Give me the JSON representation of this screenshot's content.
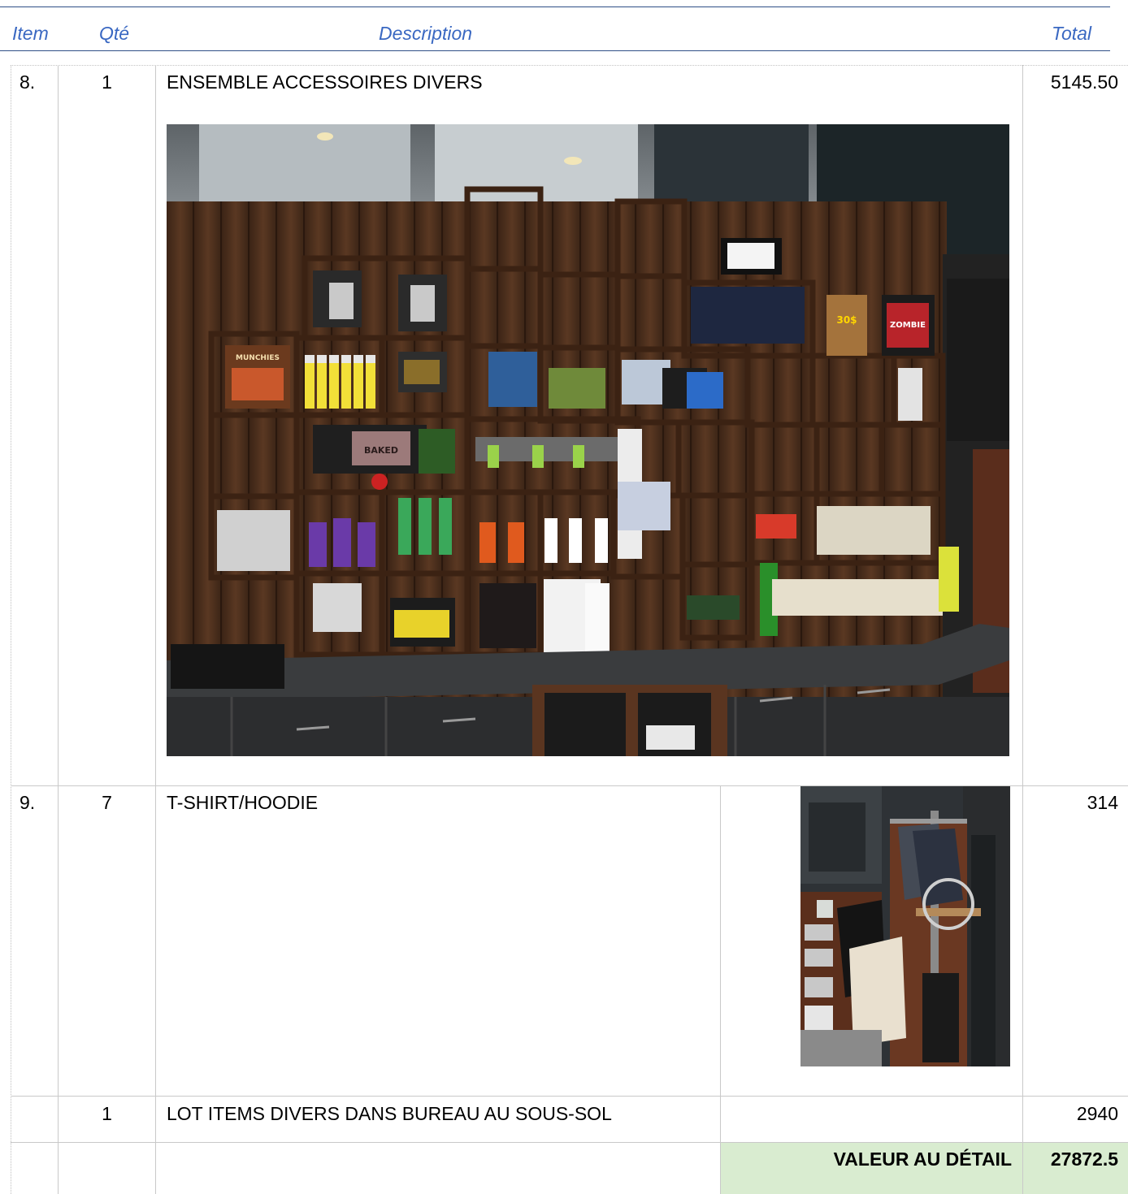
{
  "header": {
    "item": "Item",
    "qty": "Qté",
    "description": "Description",
    "total": "Total"
  },
  "rows": [
    {
      "item": "8.",
      "qty": "1",
      "description": "ENSEMBLE ACCESSOIRES DIVERS",
      "total": "5145.50",
      "photo": "shelving-display-photo"
    },
    {
      "item": "9.",
      "qty": "7",
      "description": "T-SHIRT/HOODIE",
      "total": "314",
      "photo": "clothing-rack-photo"
    },
    {
      "item": "",
      "qty": "1",
      "description": "LOT ITEMS DIVERS DANS BUREAU AU SOUS-SOL",
      "total": "2940"
    }
  ],
  "summary": {
    "label": "VALEUR AU DÉTAIL",
    "value": "27872.5"
  },
  "photo_labels": {
    "book": "MUNCHIES",
    "bag": "30$",
    "zombie": "ZOMBIE",
    "baked": "BAKED"
  },
  "colors": {
    "header_text": "#3a68c2",
    "header_rule": "#2f4f86",
    "summary_fill": "#d9ecd0"
  }
}
